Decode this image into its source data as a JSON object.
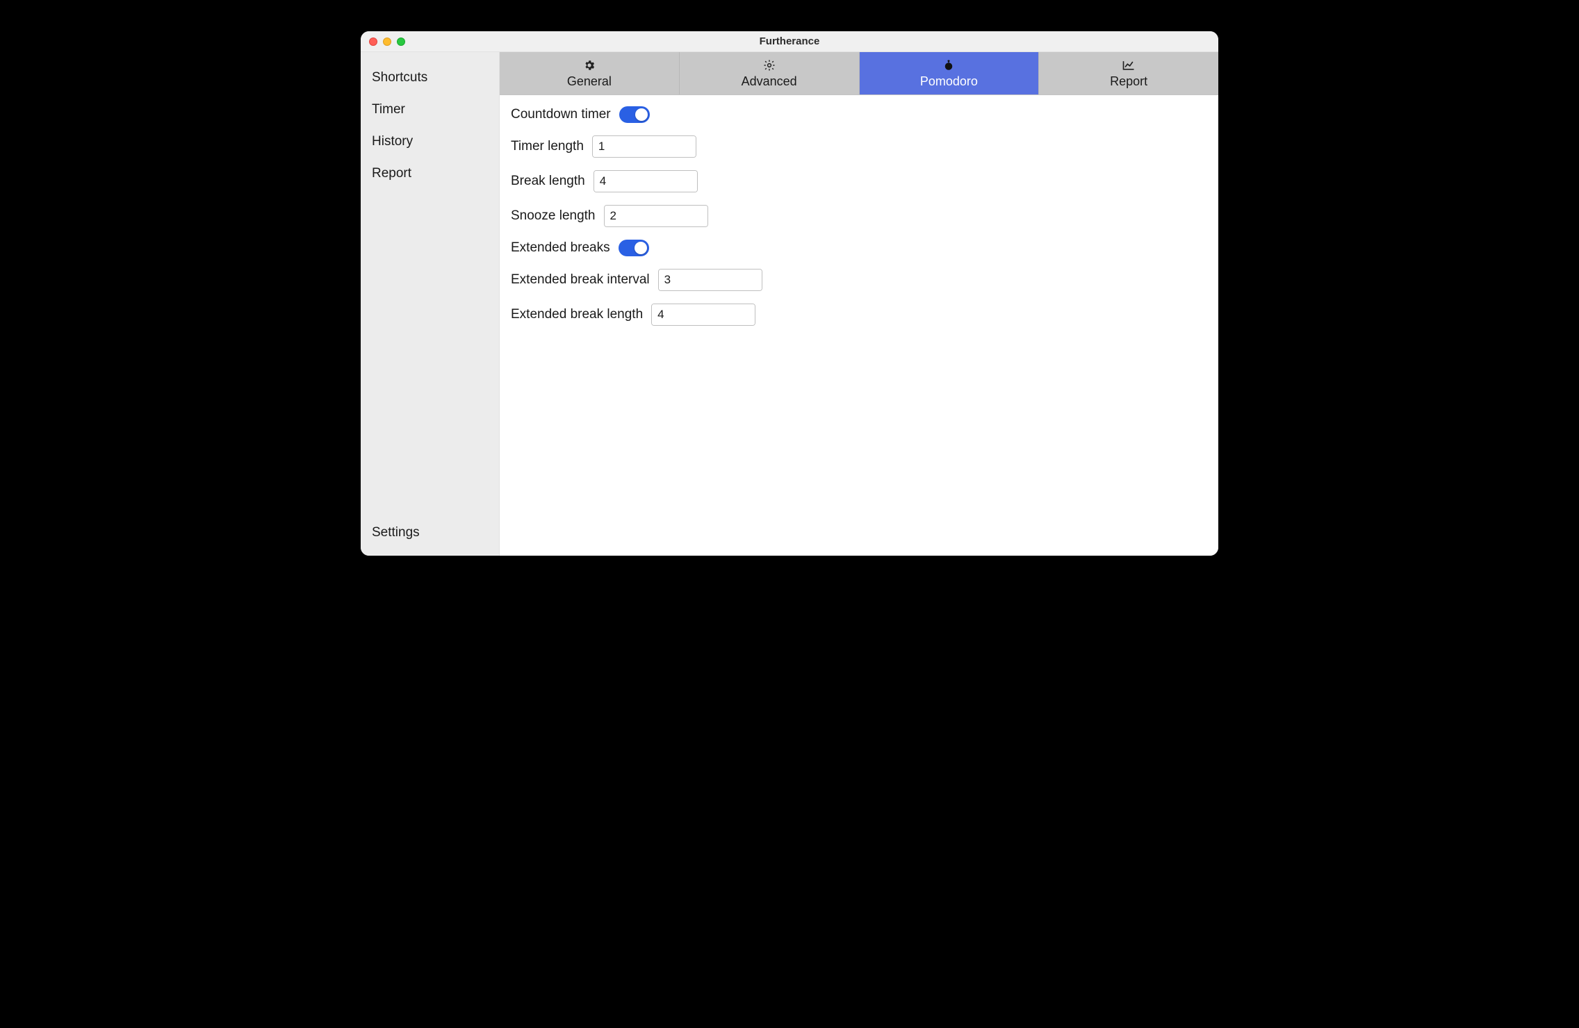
{
  "window": {
    "title": "Furtherance"
  },
  "sidebar": {
    "items": [
      {
        "label": "Shortcuts"
      },
      {
        "label": "Timer"
      },
      {
        "label": "History"
      },
      {
        "label": "Report"
      }
    ],
    "footer": {
      "label": "Settings"
    }
  },
  "tabs": [
    {
      "label": "General",
      "icon": "gear",
      "active": false
    },
    {
      "label": "Advanced",
      "icon": "gearwheel",
      "active": false
    },
    {
      "label": "Pomodoro",
      "icon": "stopwatch",
      "active": true
    },
    {
      "label": "Report",
      "icon": "chart",
      "active": false
    }
  ],
  "settings": {
    "countdown_timer": {
      "label": "Countdown timer",
      "on": true
    },
    "timer_length": {
      "label": "Timer length",
      "value": "1"
    },
    "break_length": {
      "label": "Break length",
      "value": "4"
    },
    "snooze_length": {
      "label": "Snooze length",
      "value": "2"
    },
    "extended_breaks": {
      "label": "Extended breaks",
      "on": true
    },
    "extended_break_interval": {
      "label": "Extended break interval",
      "value": "3"
    },
    "extended_break_length": {
      "label": "Extended break length",
      "value": "4"
    }
  },
  "colors": {
    "accent": "#2a60e4",
    "tab_active": "#5871e0"
  }
}
